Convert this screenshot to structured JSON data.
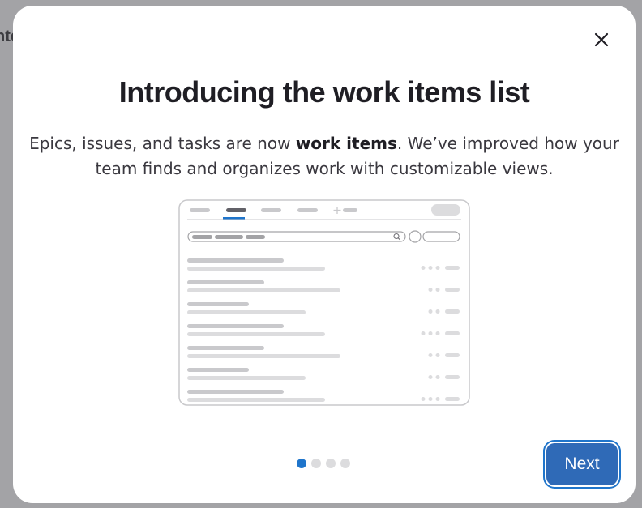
{
  "backdrop": {
    "partial_text": "nte"
  },
  "modal": {
    "title": "Introducing the work items list",
    "description_before": "Epics, issues, and tasks are now ",
    "description_bold": "work items",
    "description_after": ". We’ve improved how your team finds and organizes work with customizable views.",
    "close_icon": "close-icon",
    "illustration": {
      "tab_count": 4,
      "active_tab": 2,
      "row_count": 7
    },
    "pagination": {
      "total": 4,
      "current": 1
    },
    "next_label": "Next"
  },
  "colors": {
    "accent": "#1f75cb",
    "button": "#2f6ab7",
    "title": "#1f1e24",
    "text": "#3a383f",
    "backdrop": "#a3a3a6"
  }
}
